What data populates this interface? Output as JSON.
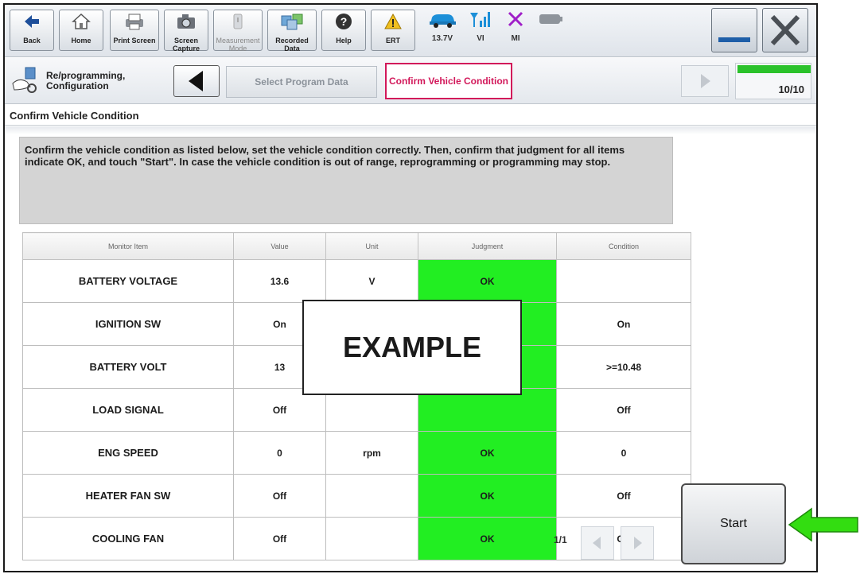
{
  "toolbar": {
    "back": "Back",
    "home": "Home",
    "print_screen": "Print Screen",
    "screen_capture": "Screen Capture",
    "measurement_mode": "Measurement Mode",
    "recorded_data": "Recorded Data",
    "help": "Help",
    "ert": "ERT",
    "voltage": "13.7V",
    "vi": "VI",
    "mi": "MI"
  },
  "nav": {
    "section_label": "Re/programming, Configuration",
    "prev_step": "Select Program Data",
    "current_step": "Confirm Vehicle Condition",
    "page_counter": "10/10",
    "progress_fraction": 1.0
  },
  "page_title": "Confirm Vehicle Condition",
  "instruction": "Confirm the vehicle condition as listed below, set the vehicle condition correctly. Then, confirm that judgment for all items indicate OK, and touch \"Start\". In case the vehicle condition is out of range, reprogramming or programming may stop.",
  "table": {
    "headers": [
      "Monitor Item",
      "Value",
      "Unit",
      "Judgment",
      "Condition"
    ],
    "rows": [
      {
        "item": "BATTERY VOLTAGE",
        "value": "13.6",
        "unit": "V",
        "judgment": "OK",
        "condition": ""
      },
      {
        "item": "IGNITION SW",
        "value": "On",
        "unit": "",
        "judgment": "",
        "condition": "On"
      },
      {
        "item": "BATTERY VOLT",
        "value": "13",
        "unit": "",
        "judgment": "",
        "condition": ">=10.48"
      },
      {
        "item": "LOAD SIGNAL",
        "value": "Off",
        "unit": "",
        "judgment": "",
        "condition": "Off"
      },
      {
        "item": "ENG SPEED",
        "value": "0",
        "unit": "rpm",
        "judgment": "OK",
        "condition": "0"
      },
      {
        "item": "HEATER FAN SW",
        "value": "Off",
        "unit": "",
        "judgment": "OK",
        "condition": "Off"
      },
      {
        "item": "COOLING FAN",
        "value": "Off",
        "unit": "",
        "judgment": "OK",
        "condition": "Off"
      }
    ]
  },
  "example_label": "EXAMPLE",
  "pager": "1/1",
  "start_label": "Start",
  "colors": {
    "ok_green": "#22ee22",
    "active_step": "#d2185a",
    "arrow_green": "#33dd11",
    "mi_x": "#a020c8",
    "ert_warning": "#f0c020",
    "vehicle_blue": "#1c8fd8"
  }
}
